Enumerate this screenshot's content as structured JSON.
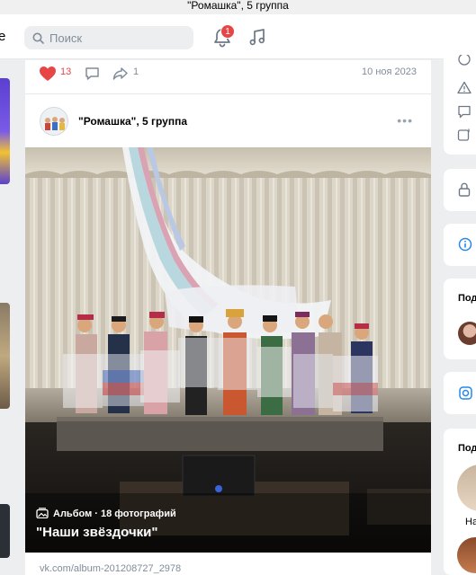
{
  "window": {
    "title": "\"Ромашка\", 5 группа"
  },
  "topbar": {
    "logo_fragment": "е",
    "search_placeholder": "Поиск",
    "notifications_count": "1"
  },
  "post": {
    "likes": "13",
    "shares": "1",
    "date": "10 ноя 2023",
    "author": "\"Ромашка\", 5 группа",
    "album_meta": "Альбом · 18 фотографий",
    "album_title": "\"Наши звёздочки\"",
    "link": "vk.com/album-201208727_2978"
  },
  "right_column": {
    "section_1": "Под",
    "section_2": "Под",
    "friend_name": "На"
  },
  "colors": {
    "like": "#e64646",
    "badge": "#e64646",
    "accent": "#2688eb"
  }
}
